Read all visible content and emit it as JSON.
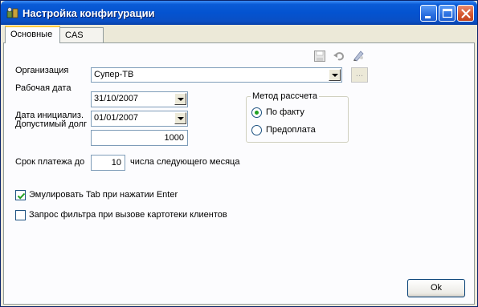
{
  "window": {
    "title": "Настройка конфигурации"
  },
  "tabs": [
    {
      "label": "Основные",
      "active": true
    },
    {
      "label": "CAS",
      "active": false
    }
  ],
  "toolbar": {
    "icons": [
      "save-icon",
      "undo-icon",
      "edit-pen-icon"
    ]
  },
  "form": {
    "organization": {
      "label": "Организация",
      "value": "Супер-ТВ",
      "button_label": "..."
    },
    "work_date": {
      "label": "Рабочая дата",
      "value": "31/10/2007"
    },
    "init_date": {
      "label": "Дата инициализ.",
      "value": "01/01/2007"
    },
    "allowed_debt": {
      "label": "Допустимый долг",
      "value": "1000"
    },
    "payment_term": {
      "label": "Срок платежа до",
      "value": "10",
      "suffix": "числа следующего месяца"
    }
  },
  "calc_method": {
    "title": "Метод рассчета",
    "options": [
      {
        "label": "По факту",
        "selected": true
      },
      {
        "label": "Предоплата",
        "selected": false
      }
    ]
  },
  "options": [
    {
      "label": "Эмулировать Tab при нажатии Enter",
      "checked": true
    },
    {
      "label": "Запрос фильтра при вызове картотеки клиентов",
      "checked": false
    }
  ],
  "buttons": {
    "ok": "Ok"
  },
  "colors": {
    "titlebar": "#0453d0",
    "panel_bg": "#fcfcfe",
    "window_bg": "#ece9d8",
    "radio_dot": "#21a121",
    "check_mark": "#21a121"
  }
}
